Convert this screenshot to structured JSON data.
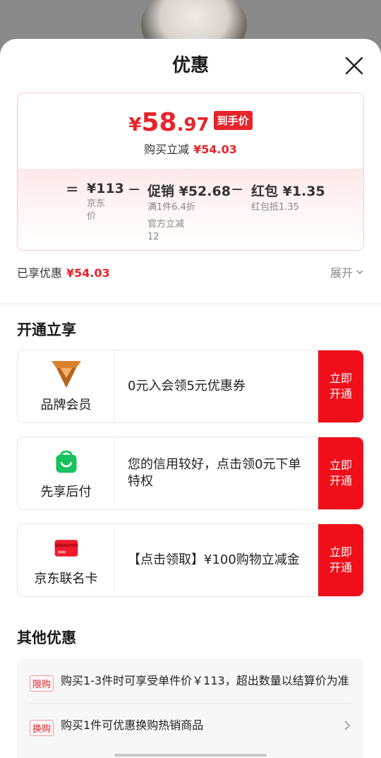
{
  "header": {
    "title": "优惠"
  },
  "price": {
    "currency": "¥",
    "integer": "58",
    "decimal": ".97",
    "tag": "到手价",
    "save_label": "购买立减",
    "save_amount": "¥54.03"
  },
  "formula": {
    "eq": "=",
    "minus1": "−",
    "minus2": "−",
    "base_value": "¥113",
    "base_label_1": "京东",
    "base_label_2": "价",
    "promo_value": "促销 ¥52.68",
    "promo_sub_1": "满1件6.4折",
    "promo_sub_2": "官方立减",
    "promo_sub_3": "12",
    "redpack_value": "红包 ¥1.35",
    "redpack_sub": "红包抵1.35"
  },
  "enjoyed": {
    "label": "已享优惠",
    "amount": "¥54.03",
    "expand": "展开"
  },
  "open_section": {
    "title": "开通立享",
    "cards": [
      {
        "label": "品牌会员",
        "text": "0元入会领5元优惠券",
        "button": "立即开通",
        "icon": "brand-v-icon"
      },
      {
        "label": "先享后付",
        "text": "您的信用较好，点击领0元下单特权",
        "button": "立即开通",
        "icon": "shopping-bag-smile-icon"
      },
      {
        "label": "京东联名卡",
        "text": "【点击领取】¥100购物立减金",
        "button": "立即开通",
        "icon": "credit-card-icon"
      }
    ]
  },
  "other_section": {
    "title": "其他优惠",
    "items": [
      {
        "badge": "限购",
        "text": "购买1-3件时可享受单件价￥113，超出数量以结算价为准"
      },
      {
        "badge": "换购",
        "text": "购买1件可优惠换购热销商品"
      }
    ]
  },
  "colors": {
    "accent": "#e8232a",
    "button": "#f00e1a",
    "member_gold": "#d9822b",
    "payafter_green": "#19c25e"
  }
}
